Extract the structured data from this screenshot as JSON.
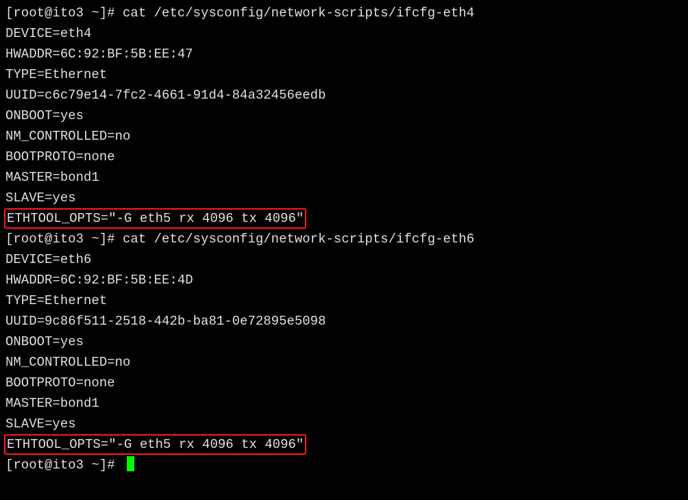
{
  "prompt1": "[root@ito3 ~]# ",
  "cmd1": "cat /etc/sysconfig/network-scripts/ifcfg-eth4",
  "eth4": {
    "device": "DEVICE=eth4",
    "hwaddr": "HWADDR=6C:92:BF:5B:EE:47",
    "type": "TYPE=Ethernet",
    "uuid": "UUID=c6c79e14-7fc2-4661-91d4-84a32456eedb",
    "onboot": "ONBOOT=yes",
    "nm": "NM_CONTROLLED=no",
    "bootproto": "BOOTPROTO=none",
    "master": "MASTER=bond1",
    "slave": "SLAVE=yes",
    "ethtool": "ETHTOOL_OPTS=\"-G eth5 rx 4096 tx 4096\""
  },
  "prompt2": "[root@ito3 ~]# ",
  "cmd2": "cat /etc/sysconfig/network-scripts/ifcfg-eth6",
  "eth6": {
    "device": "DEVICE=eth6",
    "hwaddr": "HWADDR=6C:92:BF:5B:EE:4D",
    "type": "TYPE=Ethernet",
    "uuid": "UUID=9c86f511-2518-442b-ba81-0e72895e5098",
    "onboot": "ONBOOT=yes",
    "nm": "NM_CONTROLLED=no",
    "bootproto": "BOOTPROTO=none",
    "master": "MASTER=bond1",
    "slave": "SLAVE=yes",
    "ethtool": "ETHTOOL_OPTS=\"-G eth5 rx 4096 tx 4096\""
  },
  "prompt3": "[root@ito3 ~]# "
}
